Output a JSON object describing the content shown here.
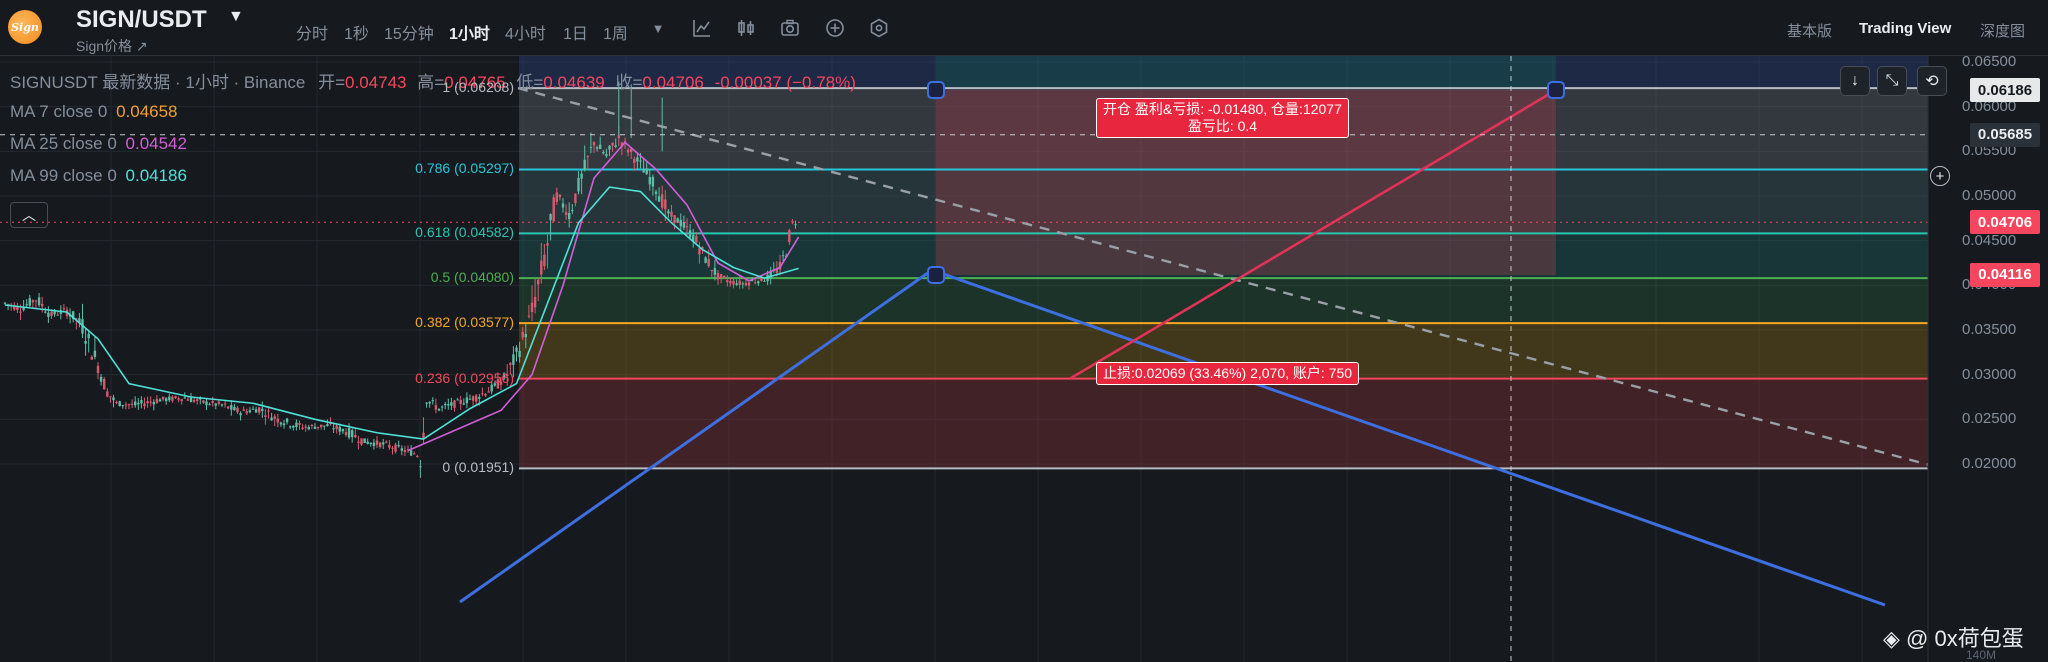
{
  "header": {
    "logo_text": "Sign",
    "pair": "SIGN/USDT",
    "subtitle": "Sign价格 ↗",
    "timeframes": [
      "分时",
      "1秒",
      "15分钟",
      "1小时",
      "4小时",
      "1日",
      "1周"
    ],
    "active_timeframe": "1小时",
    "tool_icons": [
      "dropdown-caret-icon",
      "indicator-icon",
      "candle-type-icon",
      "camera-icon",
      "plus-circle-icon",
      "settings-hex-icon"
    ],
    "view_tabs": [
      "基本版",
      "Trading View",
      "深度图"
    ],
    "active_view": "Trading View"
  },
  "legend": {
    "symbol_line": "SIGNUSDT 最新数据 · 1小时 · Binance",
    "open_label": "开=",
    "open": "0.04743",
    "high_label": "高=",
    "high": "0.04765",
    "low_label": "低=",
    "low": "0.04639",
    "close_label": "收=",
    "close": "0.04706",
    "change": "-0.00037 (−0.78%)",
    "ma": [
      {
        "label": "MA 7 close 0",
        "value": "0.04658",
        "color": "#f0a030"
      },
      {
        "label": "MA 25 close 0",
        "value": "0.04542",
        "color": "#d25fd8"
      },
      {
        "label": "MA 99 close 0",
        "value": "0.04186",
        "color": "#4fe0d8"
      }
    ],
    "collapse_icon": "chevron-up-icon"
  },
  "chart_data": {
    "type": "candlestick",
    "symbol": "SIGNUSDT",
    "interval": "1小时",
    "ohlc_last": {
      "open": 0.04743,
      "high": 0.04765,
      "low": 0.04639,
      "close": 0.04706
    },
    "price_axis_ticks": [
      "0.06500",
      "0.06000",
      "0.05500",
      "0.05000",
      "0.04500",
      "0.04000",
      "0.03500",
      "0.03000",
      "0.02500",
      "0.02000"
    ],
    "ylim": [
      0.0195,
      0.0655
    ],
    "price_path": [
      [
        0,
        0.038
      ],
      [
        5,
        0.0374
      ],
      [
        10,
        0.0385
      ],
      [
        15,
        0.0367
      ],
      [
        20,
        0.0372
      ],
      [
        25,
        0.0355
      ],
      [
        30,
        0.031
      ],
      [
        33,
        0.028
      ],
      [
        36,
        0.0268
      ],
      [
        42,
        0.0266
      ],
      [
        50,
        0.0272
      ],
      [
        58,
        0.0274
      ],
      [
        64,
        0.0269
      ],
      [
        70,
        0.0266
      ],
      [
        76,
        0.0258
      ],
      [
        82,
        0.0262
      ],
      [
        88,
        0.025
      ],
      [
        96,
        0.0241
      ],
      [
        104,
        0.0243
      ],
      [
        110,
        0.0237
      ],
      [
        116,
        0.0225
      ],
      [
        122,
        0.0222
      ],
      [
        128,
        0.0216
      ],
      [
        132,
        0.0212
      ],
      [
        134,
        0.0208
      ],
      [
        136,
        0.0272
      ],
      [
        140,
        0.0262
      ],
      [
        146,
        0.0268
      ],
      [
        152,
        0.0275
      ],
      [
        158,
        0.0286
      ],
      [
        162,
        0.03
      ],
      [
        166,
        0.033
      ],
      [
        170,
        0.037
      ],
      [
        174,
        0.043
      ],
      [
        178,
        0.05
      ],
      [
        182,
        0.048
      ],
      [
        186,
        0.052
      ],
      [
        190,
        0.056
      ],
      [
        194,
        0.0545
      ],
      [
        198,
        0.0565
      ],
      [
        202,
        0.0548
      ],
      [
        206,
        0.053
      ],
      [
        210,
        0.051
      ],
      [
        214,
        0.048
      ],
      [
        218,
        0.047
      ],
      [
        222,
        0.0455
      ],
      [
        226,
        0.043
      ],
      [
        230,
        0.041
      ],
      [
        234,
        0.0404
      ],
      [
        238,
        0.0402
      ],
      [
        242,
        0.0405
      ],
      [
        246,
        0.0408
      ],
      [
        250,
        0.042
      ],
      [
        252,
        0.044
      ],
      [
        254,
        0.047
      ],
      [
        256,
        0.0471
      ]
    ],
    "ma_series": [
      {
        "label": "MA 25",
        "color": "#d25fd8",
        "points": [
          [
            130,
            0.0215
          ],
          [
            160,
            0.026
          ],
          [
            170,
            0.03
          ],
          [
            180,
            0.04
          ],
          [
            190,
            0.052
          ],
          [
            200,
            0.056
          ],
          [
            210,
            0.053
          ],
          [
            220,
            0.049
          ],
          [
            230,
            0.0425
          ],
          [
            240,
            0.0405
          ],
          [
            250,
            0.042
          ],
          [
            256,
            0.0454
          ]
        ]
      },
      {
        "label": "MA 99",
        "color": "#4fe0d8",
        "points": [
          [
            0,
            0.0378
          ],
          [
            20,
            0.037
          ],
          [
            30,
            0.034
          ],
          [
            40,
            0.029
          ],
          [
            60,
            0.0275
          ],
          [
            80,
            0.0268
          ],
          [
            100,
            0.025
          ],
          [
            120,
            0.0235
          ],
          [
            135,
            0.0228
          ],
          [
            150,
            0.0262
          ],
          [
            165,
            0.029
          ],
          [
            175,
            0.038
          ],
          [
            185,
            0.047
          ],
          [
            195,
            0.051
          ],
          [
            205,
            0.0505
          ],
          [
            215,
            0.047
          ],
          [
            225,
            0.044
          ],
          [
            235,
            0.042
          ],
          [
            245,
            0.0408
          ],
          [
            256,
            0.0419
          ]
        ]
      }
    ],
    "fibonacci": [
      {
        "ratio": "1",
        "price": "0.06208",
        "color": "#b7bdc6"
      },
      {
        "ratio": "0.786",
        "price": "0.05297",
        "color": "#26c6da"
      },
      {
        "ratio": "0.618",
        "price": "0.04582",
        "color": "#26c6b0"
      },
      {
        "ratio": "0.5",
        "price": "0.04080",
        "color": "#4caf50"
      },
      {
        "ratio": "0.382",
        "price": "0.03577",
        "color": "#f5a623"
      },
      {
        "ratio": "0.236",
        "price": "0.02956",
        "color": "#f6465d"
      },
      {
        "ratio": "0",
        "price": "0.01951",
        "color": "#b7bdc6"
      }
    ],
    "fib_label_format": "{ratio} ({price})",
    "position": {
      "type": "short",
      "entry_price": 0.04116,
      "target_price": 0.06186,
      "target_box": "开仓 盈利&亏损: -0.01480, 仓量:12077\n盈亏比: 0.4",
      "stop_box": "止损:0.02069 (33.46%) 2,070, 账户: 750"
    },
    "price_tags": [
      {
        "price": "0.06186",
        "style": "neutral"
      },
      {
        "price": "0.05685",
        "style": "dark"
      },
      {
        "price": "0.04706",
        "style": "red"
      },
      {
        "price": "0.04116",
        "style": "red"
      }
    ],
    "crosshair_price": 0.05685,
    "volume_axis_label": "140M"
  },
  "corner_buttons": [
    "arrow-down-icon",
    "collapse-arrows-icon",
    "refresh-icon"
  ],
  "watermark": "@ 0x荷包蛋",
  "watermark_icon": "binance-diamond-icon"
}
